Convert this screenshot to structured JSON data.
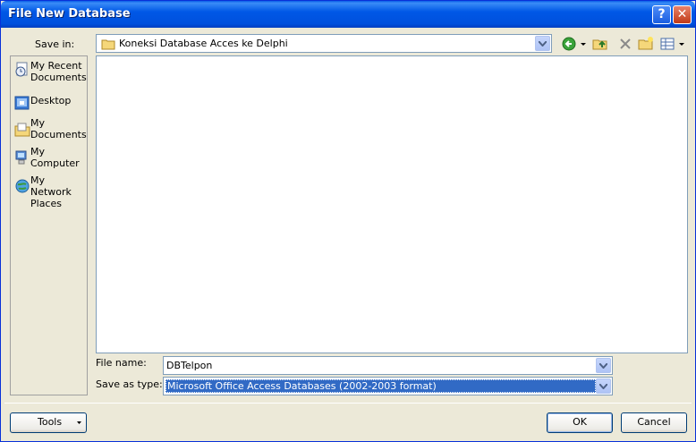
{
  "window": {
    "title": "File New Database"
  },
  "title_buttons": {
    "help": "?",
    "close": "✕"
  },
  "save_in": {
    "label": "Save in:",
    "value": "Koneksi Database Acces ke Delphi"
  },
  "toolbar": {
    "icons": [
      "back-icon",
      "dropdown-arrow-icon",
      "up-folder-icon",
      "delete-icon",
      "new-folder-icon",
      "views-icon",
      "dropdown-arrow-icon"
    ]
  },
  "places": [
    {
      "label": "My Recent Documents",
      "line1": "My Recent",
      "line2": "Documents",
      "icon": "recent-documents-icon"
    },
    {
      "label": "Desktop",
      "line1": "Desktop",
      "line2": "",
      "icon": "desktop-icon"
    },
    {
      "label": "My Documents",
      "line1": "My",
      "line2": "Documents",
      "icon": "my-documents-icon"
    },
    {
      "label": "My Computer",
      "line1": "My",
      "line2": "Computer",
      "icon": "my-computer-icon"
    },
    {
      "label": "My Network Places",
      "line1": "My Network",
      "line2": "Places",
      "icon": "network-places-icon"
    }
  ],
  "file_name": {
    "label": "File name:",
    "value": "DBTelpon"
  },
  "save_as_type": {
    "label": "Save as type:",
    "value": "Microsoft Office Access Databases (2002-2003 format)"
  },
  "buttons": {
    "tools": "Tools",
    "ok": "OK",
    "cancel": "Cancel"
  }
}
